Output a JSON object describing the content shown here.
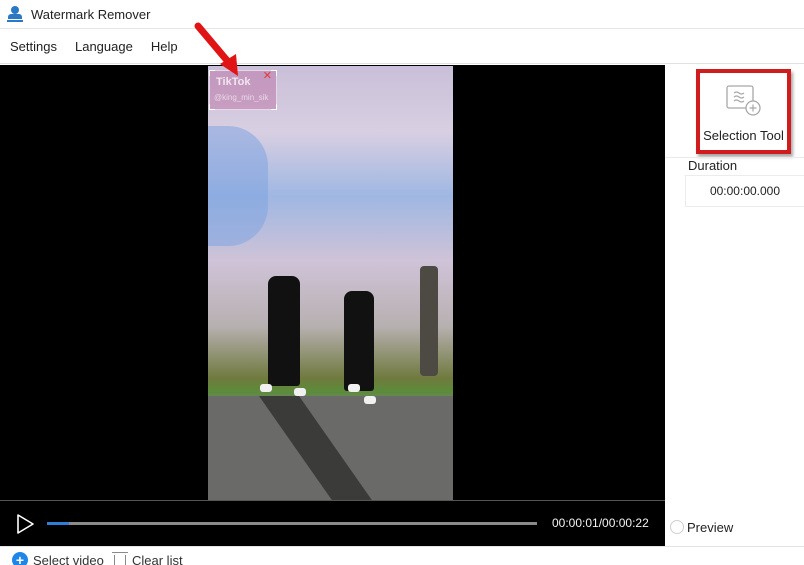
{
  "window": {
    "title": "Watermark Remover",
    "app_icon": "stamp-icon"
  },
  "menu": {
    "items": [
      {
        "label": "Settings"
      },
      {
        "label": "Language"
      },
      {
        "label": "Help"
      }
    ]
  },
  "player": {
    "watermark": {
      "logo_text": "TikTok",
      "user_text": "@king_min_sik",
      "close_symbol": "✕"
    },
    "current_time": "00:00:01",
    "total_time": "00:00:22",
    "time_readout": "00:00:01/00:00:22",
    "progress_fraction": 0.045,
    "play_icon": "play-icon",
    "accent_color": "#2f7ed8"
  },
  "right_panel": {
    "selection_tool_label": "Selection Tool",
    "duration_label": "Duration",
    "duration_value": "00:00:00.000",
    "preview_label": "Preview",
    "highlight_color": "#d01c1c"
  },
  "bottom_bar": {
    "select_video_label": "Select video",
    "clear_list_label": "Clear list",
    "select_icon_color": "#1d86e8"
  }
}
